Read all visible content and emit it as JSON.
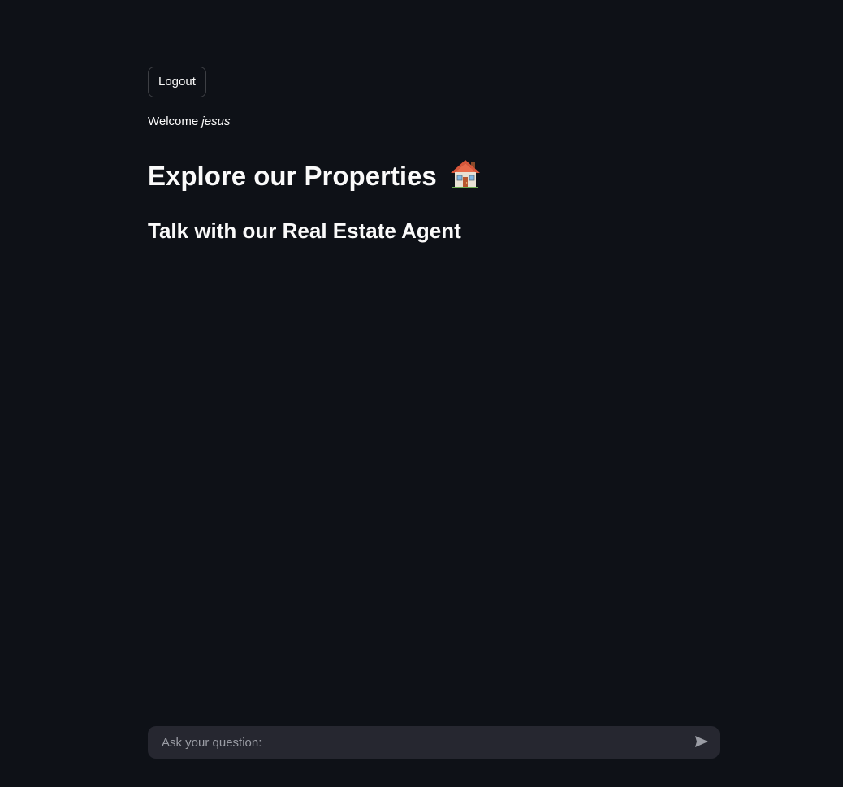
{
  "header": {
    "logout_label": "Logout"
  },
  "welcome": {
    "prefix": "Welcome",
    "username": "jesus"
  },
  "main": {
    "title": "Explore our Properties",
    "title_icon": "house-icon",
    "subtitle": "Talk with our Real Estate Agent"
  },
  "chat": {
    "placeholder": "Ask your question:",
    "value": "",
    "send_icon": "send-icon"
  },
  "colors": {
    "background": "#0e1117",
    "text": "#fafafa",
    "input_background": "#262730",
    "placeholder": "#9a9ca4"
  }
}
